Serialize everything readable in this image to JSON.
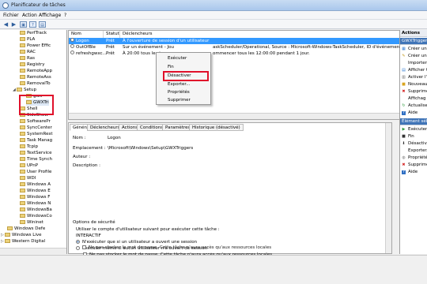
{
  "window": {
    "title": "Planificateur de tâches"
  },
  "menu": [
    "Fichier",
    "Action",
    "Affichage",
    "?"
  ],
  "tree": {
    "items": [
      "PerfTrack",
      "PLA",
      "Power Effic",
      "RAC",
      "Ras",
      "Registry",
      "RemoteApp",
      "RemoteAss",
      "RemovalTo",
      "Setup",
      "gwx",
      "GWXTri",
      "Shell",
      "SideShow",
      "SoftwarePr",
      "SyncCenter",
      "SystemRest",
      "Task Manag",
      "Tcpip",
      "TextService",
      "Time Synch",
      "UPnP",
      "User Profile",
      "WDI",
      "Windows A",
      "Windows E",
      "Windows F",
      "Windows N",
      "WindowsBa",
      "WindowsCo",
      "Wininet",
      "Windows Defe",
      "Windows Live",
      "Western Digital"
    ]
  },
  "tasks": {
    "columns": [
      "Nom",
      "Statut",
      "Déclencheurs"
    ],
    "rows": [
      {
        "name": "Logon",
        "status": "Prêt",
        "trigger": "À l'ouverture de session d'un utilisateur"
      },
      {
        "name": "OutOfBle",
        "status": "Prêt",
        "trigger": "Sur un événement - Jou",
        "trigger2": "askScheduler/Operational, Source : Microsoft-Windows-TaskScheduler, ID d'événement : 128"
      },
      {
        "name": "refreshgwxc...",
        "status": "Prêt",
        "trigger": "À 20:00 tous les jours -",
        "trigger2": "ommencer tous les 12:00:00 pendant 1 jour."
      }
    ]
  },
  "context_menu": [
    "Exécuter",
    "Fin",
    "Désactiver",
    "Exporter...",
    "Propriétés",
    "Supprimer"
  ],
  "detail": {
    "tabs": [
      "Général",
      "Déclencheurs",
      "Actions",
      "Conditions",
      "Paramètres",
      "Historique (désactivé)"
    ],
    "name_label": "Nom :",
    "name_value": "Logon",
    "location_label": "Emplacement :",
    "location_value": "\\Microsoft\\Windows\\Setup\\GWXTriggers",
    "author_label": "Auteur :",
    "description_label": "Description :",
    "security_label": "Options de sécurité",
    "account_label": "Utiliser le compte d'utilisateur suivant pour exécuter cette tâche :",
    "account_value": "INTERACTIF",
    "opt_logged": "N'exécuter que si un utilisateur a ouvert une session",
    "opt_any": "Exécuter même si aucun utilisateur n'a ouvert de session",
    "opt_nopwd": "Ne pas stocker le mot de passe. Cette tâche n'aura accès qu'aux ressources locales",
    "opt_highest": "Exécuter avec les autorisations maximales"
  },
  "actions": {
    "header": "Actions",
    "selected": "GWXTriggers",
    "group1": [
      {
        "icon": "create-basic-task-icon",
        "label": "Créer une"
      },
      {
        "icon": "create-task-icon",
        "label": "Créer une"
      },
      {
        "icon": "",
        "label": "Importer"
      },
      {
        "icon": "display-all-icon",
        "label": "Afficher t"
      },
      {
        "icon": "enable-history-icon",
        "label": "Activer l'h"
      },
      {
        "icon": "new-folder-icon",
        "label": "Nouveau"
      },
      {
        "icon": "delete-folder-icon",
        "label": "Supprime"
      },
      {
        "icon": "",
        "label": "Affichag"
      },
      {
        "icon": "refresh-icon",
        "label": "Actualise"
      },
      {
        "icon": "help-icon",
        "label": "Aide"
      }
    ],
    "selected_header": "Élément sélect",
    "group2": [
      {
        "icon": "run-icon",
        "label": "Exécuter"
      },
      {
        "icon": "end-icon",
        "label": "Fin"
      },
      {
        "icon": "disable-icon",
        "label": "Désactive"
      },
      {
        "icon": "",
        "label": "Exporter..."
      },
      {
        "icon": "properties-icon",
        "label": "Propriété"
      },
      {
        "icon": "delete-icon",
        "label": "Supprime"
      },
      {
        "icon": "help-icon",
        "label": "Aide"
      }
    ]
  },
  "colors": {
    "selection": "#3399ff",
    "highlight_box": "#e0102a",
    "folder": "#ecd27a"
  }
}
